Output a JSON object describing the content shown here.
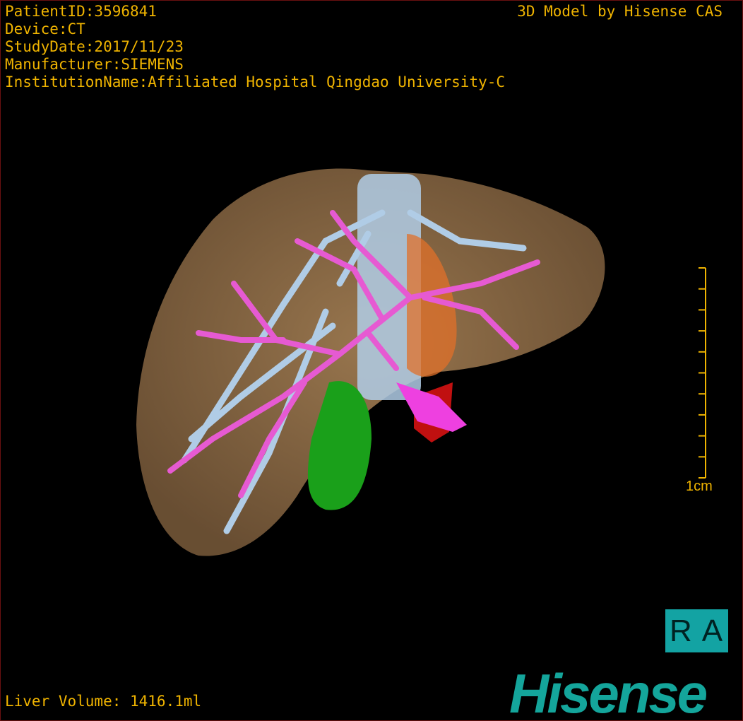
{
  "overlay": {
    "patient_id": "PatientID:3596841",
    "device": "Device:CT",
    "study_date": "StudyDate:2017/11/23",
    "manufacturer": "Manufacturer:SIEMENS",
    "institution": "InstitutionName:Affiliated Hospital Qingdao University-C",
    "brand_text": "3D Model by Hisense CAS",
    "liver_volume": "Liver Volume: 1416.1ml"
  },
  "scale_bar": {
    "label": "1cm",
    "ticks": 10
  },
  "orientation": {
    "label": "RA"
  },
  "logo": {
    "text": "Hisense"
  },
  "colors": {
    "overlay_text": "#f0b400",
    "liver": "#8a6a45",
    "hepatic_vein": "#b0cce6",
    "portal_vein": "#e65ad2",
    "gallbladder": "#1aa01a",
    "tumor": "#e0702a",
    "artery": "#c01010",
    "logo": "#14a59b",
    "orientation_box": "#13a3a3"
  }
}
